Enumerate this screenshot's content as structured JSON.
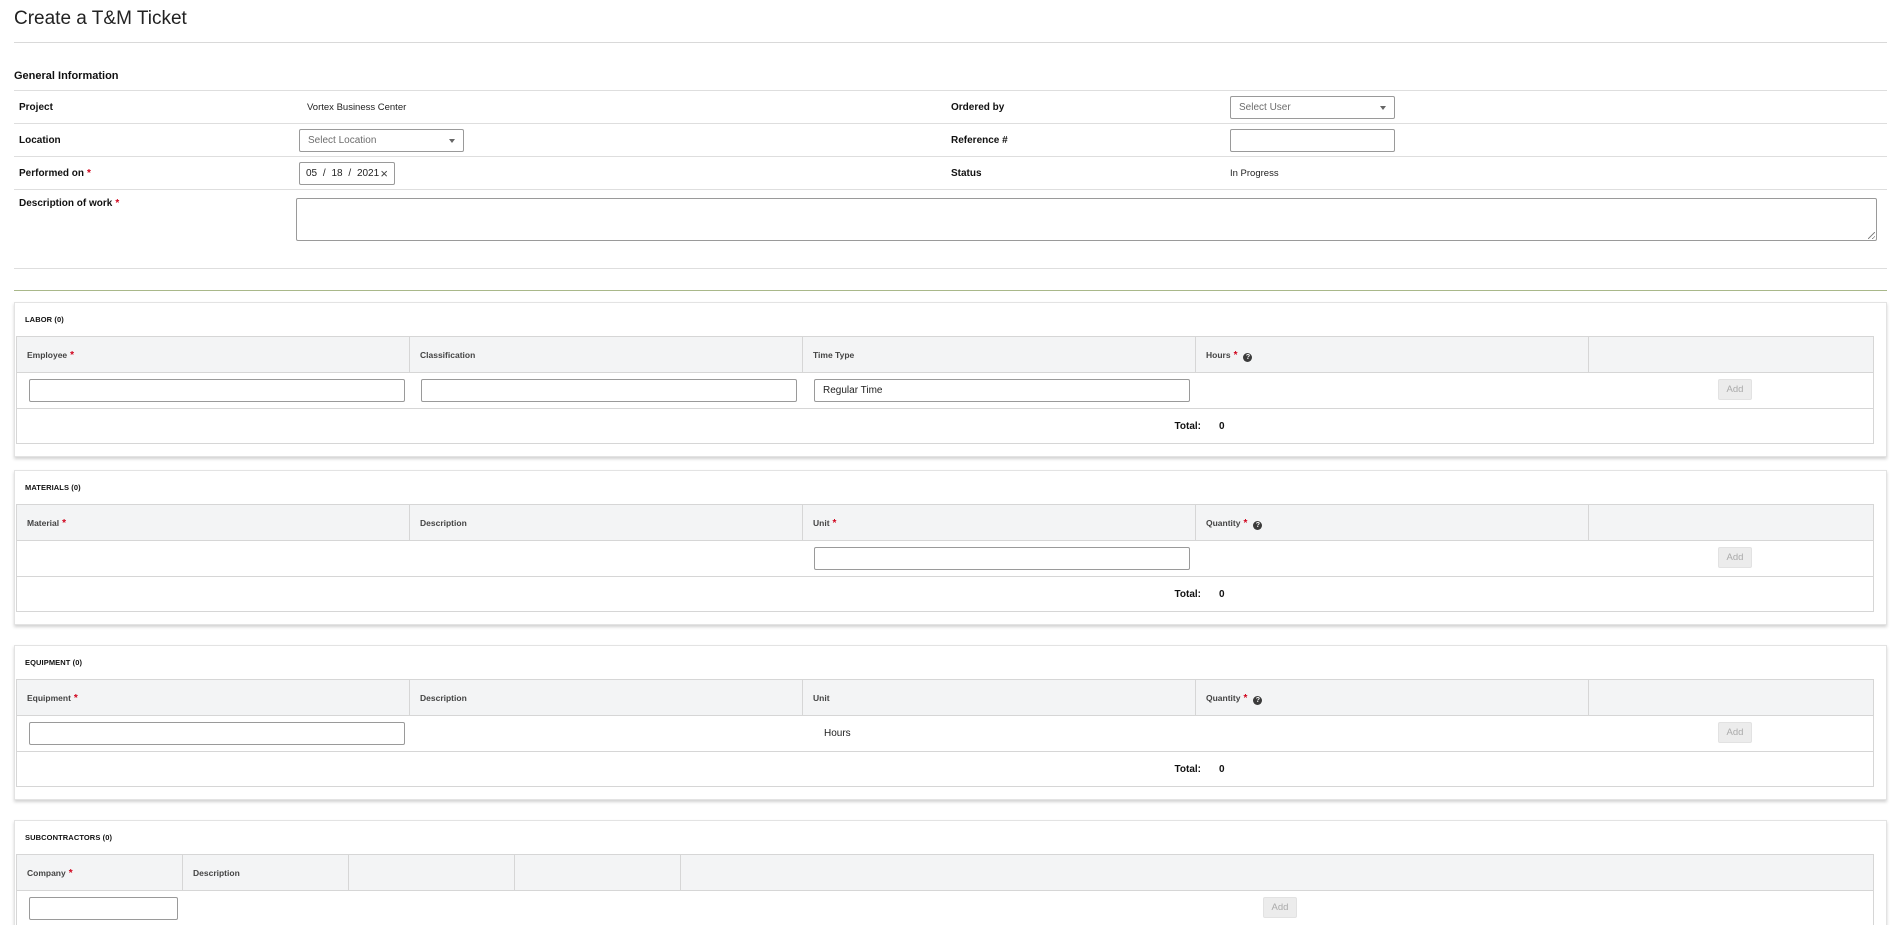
{
  "page": {
    "title": "Create a T&M Ticket"
  },
  "general": {
    "section_title": "General Information",
    "project_label": "Project",
    "project_value": "Vortex Business Center",
    "ordered_by_label": "Ordered by",
    "ordered_by_placeholder": "Select User",
    "location_label": "Location",
    "location_placeholder": "Select Location",
    "reference_label": "Reference #",
    "reference_value": "",
    "performed_on_label": "Performed on",
    "performed_on_required": "*",
    "date_month": "05",
    "date_day": "18",
    "date_year": "2021",
    "date_sep": "/",
    "date_clear": "×",
    "status_label": "Status",
    "status_value": "In Progress",
    "description_label": "Description of work",
    "description_required": "*",
    "description_value": ""
  },
  "labor": {
    "title": "LABOR (0)",
    "columns": [
      "Employee",
      "Classification",
      "Time Type",
      "Hours"
    ],
    "required": "*",
    "time_type_value": "Regular Time",
    "add_label": "Add",
    "total_label": "Total:",
    "total_value": "0"
  },
  "materials": {
    "title": "MATERIALS (0)",
    "columns": [
      "Material",
      "Description",
      "Unit",
      "Quantity"
    ],
    "required": "*",
    "add_label": "Add",
    "total_label": "Total:",
    "total_value": "0"
  },
  "equipment": {
    "title": "EQUIPMENT (0)",
    "columns": [
      "Equipment",
      "Description",
      "Unit",
      "Quantity"
    ],
    "required": "*",
    "unit_value": "Hours",
    "add_label": "Add",
    "total_label": "Total:",
    "total_value": "0"
  },
  "subcontractors": {
    "title": "SUBCONTRACTORS (0)",
    "columns": [
      "Company",
      "Description"
    ],
    "required": "*",
    "add_label": "Add"
  },
  "icons": {
    "info": "info-circle-icon",
    "dropdown": "caret-down-icon",
    "clear": "close-icon"
  },
  "colors": {
    "required": "#d0021b",
    "divider_accent": "#a9b88a",
    "header_bg": "#f3f4f5"
  }
}
